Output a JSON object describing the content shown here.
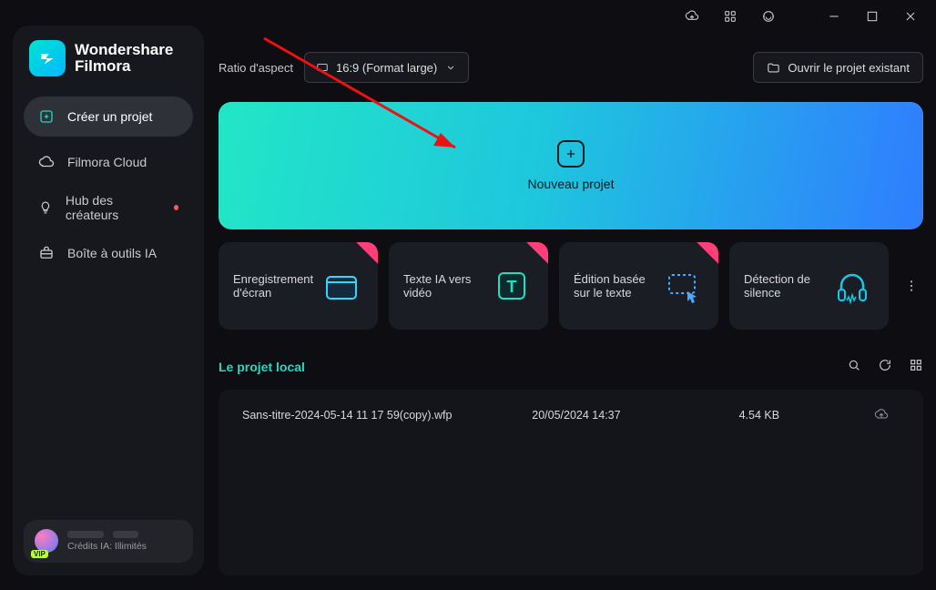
{
  "app": {
    "brand_line1": "Wondershare",
    "brand_line2": "Filmora",
    "credits_label": "Crédits IA: Illimités"
  },
  "nav": {
    "create": "Créer un projet",
    "cloud": "Filmora Cloud",
    "creators": "Hub des créateurs",
    "ai_tools": "Boîte à outils IA"
  },
  "toolbar": {
    "ratio_label": "Ratio d'aspect",
    "ratio_value": "16:9 (Format large)",
    "open_existing": "Ouvrir le projet existant"
  },
  "hero": {
    "label": "Nouveau projet"
  },
  "cards": {
    "c1": "Enregistrement d'écran",
    "c2": "Texte IA vers vidéo",
    "c3": "Édition basée sur le texte",
    "c4": "Détection de silence"
  },
  "local": {
    "title": "Le projet local",
    "rows": [
      {
        "name": "Sans-titre-2024-05-14 11 17 59(copy).wfp",
        "date": "20/05/2024 14:37",
        "size": "4.54 KB"
      }
    ]
  }
}
